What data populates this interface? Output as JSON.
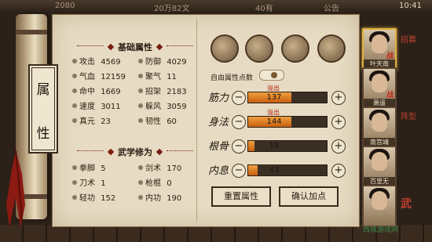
{
  "topbar": {
    "left": "2080",
    "mid": "20万82文",
    "count": "40有",
    "mail": "公告",
    "time": "10:41"
  },
  "panel": {
    "title_chars": [
      "属",
      "性"
    ],
    "basic_title": "基础属性",
    "basic_stats": [
      {
        "label": "攻击",
        "value": "4569"
      },
      {
        "label": "防御",
        "value": "4029"
      },
      {
        "label": "气血",
        "value": "12159"
      },
      {
        "label": "聚气",
        "value": "11"
      },
      {
        "label": "命中",
        "value": "1669"
      },
      {
        "label": "招架",
        "value": "2183"
      },
      {
        "label": "速度",
        "value": "3011"
      },
      {
        "label": "躲风",
        "value": "3059"
      },
      {
        "label": "真元",
        "value": "23"
      },
      {
        "label": "韧性",
        "value": "60"
      }
    ],
    "martial_title": "武学修为",
    "martial_stats": [
      {
        "label": "拳脚",
        "value": "5"
      },
      {
        "label": "剑术",
        "value": "170"
      },
      {
        "label": "刀术",
        "value": "1"
      },
      {
        "label": "枪棍",
        "value": "0"
      },
      {
        "label": "轻功",
        "value": "152"
      },
      {
        "label": "内功",
        "value": "190"
      }
    ]
  },
  "icons": [
    "hero-icon",
    "bag-icon",
    "target-icon",
    "figure-icon"
  ],
  "auto_points_label": "自由属性点数",
  "attributes": [
    {
      "name": "筋力",
      "value": "137",
      "overflow": "溢出",
      "fill": 0.55
    },
    {
      "name": "身法",
      "value": "144",
      "overflow": "溢出",
      "fill": 0.55
    },
    {
      "name": "根骨",
      "value": "19",
      "overflow": "",
      "fill": 0.08
    },
    {
      "name": "内息",
      "value": "43",
      "overflow": "",
      "fill": 0.12
    }
  ],
  "buttons": {
    "reset": "重置属性",
    "confirm": "确认加点"
  },
  "party": [
    {
      "name": "叶天南",
      "tag": "战"
    },
    {
      "name": "萧遥",
      "tag": "战"
    },
    {
      "name": "南宫靖",
      "tag": ""
    },
    {
      "name": "百里无",
      "tag": ""
    },
    {
      "name": "",
      "tag": ""
    }
  ],
  "right_tabs": [
    "招募",
    "阵型",
    "武"
  ],
  "watermark": "西城游戏网"
}
